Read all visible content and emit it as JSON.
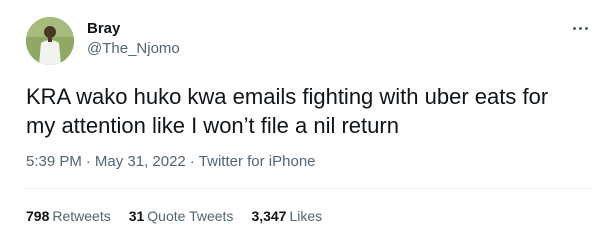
{
  "author": {
    "display_name": "Bray",
    "handle": "@The_Njomo",
    "avatar": "user-avatar"
  },
  "menu_icon": "more-horizontal-icon",
  "tweet": {
    "text": "KRA wako huko kwa emails fighting with uber eats for\nmy attention like I won’t file a nil return"
  },
  "meta": {
    "time": "5:39 PM",
    "separator": "·",
    "date": "May 31, 2022",
    "source": "Twitter for iPhone"
  },
  "stats": {
    "retweets": {
      "count": "798",
      "label": "Retweets"
    },
    "quote_tweets": {
      "count": "31",
      "label": "Quote Tweets"
    },
    "likes": {
      "count": "3,347",
      "label": "Likes"
    }
  },
  "colors": {
    "primary_text": "#0f1419",
    "secondary_text": "#536471",
    "divider": "#eff3f4"
  }
}
